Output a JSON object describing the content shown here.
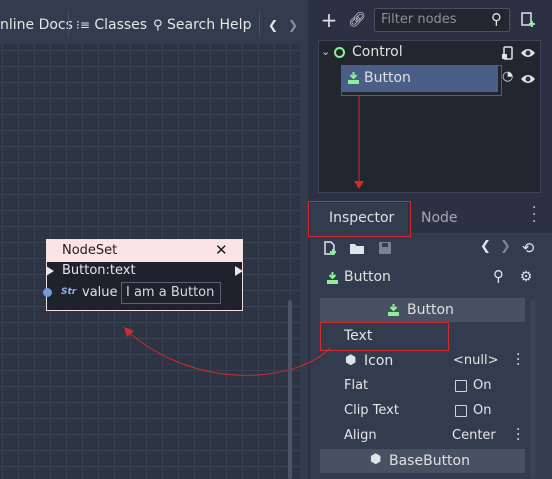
{
  "toolbar": {
    "online_docs": "nline Docs",
    "classes": "Classes",
    "search_help": "Search Help",
    "prev": "❮",
    "next": "❯"
  },
  "scene": {
    "filter_placeholder": "Filter nodes",
    "root_label": "Control",
    "child_label": "Button"
  },
  "node": {
    "title": "NodeSet",
    "close": "✕",
    "port_label": "Button:text",
    "type_badge": "Str",
    "value_label": "value",
    "value_text": "I am a Button"
  },
  "inspector": {
    "tab_inspector": "Inspector",
    "tab_node": "Node",
    "object_name": "Button",
    "section_button": "Button",
    "section_basebutton": "BaseButton",
    "props": [
      {
        "label": "Text",
        "value": ""
      },
      {
        "label": "Icon",
        "value": "<null>"
      },
      {
        "label": "Flat",
        "value": "On"
      },
      {
        "label": "Clip Text",
        "value": "On"
      },
      {
        "label": "Align",
        "value": "Center"
      }
    ]
  },
  "colors": {
    "accent_red": "#d12b2b",
    "node_header": "#fde4e4",
    "selection": "#4a5f87",
    "green_icon": "#8eef97"
  }
}
